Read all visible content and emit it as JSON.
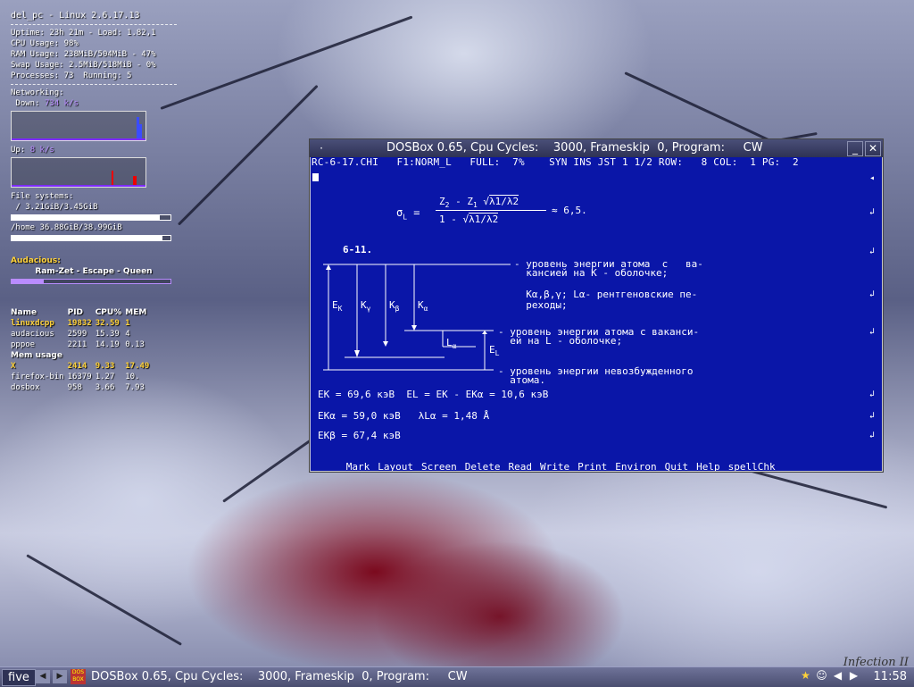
{
  "conky": {
    "host": "del_pc - Linux 2.6.17.13",
    "uptime": "Uptime: 23h 21m - Load: 1.82,1",
    "cpu": "CPU Usage: 98%",
    "cpu_fraction": 0.98,
    "ram": "RAM Usage: 238MiB/504MiB - 47%",
    "ram_fraction": 0.47,
    "swap": "Swap Usage: 2.5MiB/518MiB - 0%",
    "swap_fraction": 0.0,
    "processes": "Processes: 73  Running: 5",
    "networking": "Networking:",
    "down_label": " Down: ",
    "down_value": "734 k/s",
    "up_label": "Up: ",
    "up_value": "8 k/s",
    "filesystems": "File systems:",
    "fs_root": " / 3.21GiB/3.45GiB",
    "fs_root_fraction": 0.93,
    "fs_home": "/home 36.88GiB/38.99GiB",
    "fs_home_fraction": 0.95,
    "audacious_label": "Audacious:",
    "track": "Ram-Zet - Escape - Queen",
    "track_progress": 0.2,
    "proc_headers": [
      "Name",
      "PID",
      "CPU%",
      "MEM"
    ],
    "cpu_procs": [
      [
        "linuxdcpp",
        "19832",
        "32.59",
        "1"
      ],
      [
        "audacious",
        "2599",
        "15.39",
        "4"
      ],
      [
        "pppoe",
        "2211",
        "14.19",
        "0.13"
      ]
    ],
    "mem_usage_label": "Mem usage",
    "mem_procs": [
      [
        "X",
        "2414",
        "9.33",
        "17.49"
      ],
      [
        "firefox-bin",
        "16379",
        "1.27",
        "10."
      ],
      [
        "dosbox",
        "958",
        "3.66",
        "7.93"
      ]
    ]
  },
  "dosbox": {
    "title": "DOSBox 0.65, Cpu Cycles:    3000, Frameskip  0, Program:     CW",
    "status": "RC-6-17.CHI   F1:NORM_L   FULL:  7%    SYN INS JST 1 1/2 ROW:   8 COL:  1 PG:  2",
    "formula": {
      "sigma": "σ",
      "sigma_sub": "L",
      "numer_z2": "Z",
      "numer_z2_sub": "2",
      "numer_minus": " - ",
      "numer_z1": "Z",
      "numer_z1_sub": "1",
      "lambda_ratio": "λ1/λ2",
      "denom": "1 - ",
      "approx": "≈ 6,5."
    },
    "section": "6-11.",
    "levels": [
      "- уровень энергии атома  с   ва-",
      "  кансией на K - оболочке;",
      "  Kα,β,γ; Lα- рентгеновские пе-",
      "  реходы;",
      "- уровень энергии атома с ваканси-",
      "  ей на L - оболочке;",
      "- уровень энергии невозбужденного",
      "  атома."
    ],
    "arrow_labels": {
      "ek": "E",
      "ek_sub": "K",
      "kg": "K",
      "kg_sub": "γ",
      "kb": "K",
      "kb_sub": "β",
      "ka": "K",
      "ka_sub": "α",
      "la": "L",
      "la_sub": "α",
      "el": "E",
      "el_sub": "L"
    },
    "eq1": "E",
    "eq1_text": "K = 69,6 кэВ  E",
    "eq1_b": "L = E",
    "eq1_c": "K - E",
    "eq1_d": "Kα = 10,6 кэВ",
    "eq2_a": "E",
    "eq2_b": "Kα = 59,0 кэВ",
    "eq2_c": "λ",
    "eq2_d": "Lα = 1,48 Å",
    "eq3_a": "E",
    "eq3_b": "Kβ = 67,4 кэВ",
    "menu": [
      "Mark",
      "Layout",
      "Screen",
      "Delete",
      "Read",
      "Write",
      "Print",
      "Environ",
      "Quit",
      "Help",
      "spellChk"
    ]
  },
  "taskbar": {
    "workspace": "five",
    "task_title": "DOSBox 0.65, Cpu Cycles:    3000, Frameskip  0, Program:     CW",
    "clock": "11:58"
  },
  "wm_label": "Infection II",
  "colors": {
    "dos_bg": "#0a16a8",
    "accent_purple": "#b98cff",
    "highlight_yellow": "#ffd23a"
  }
}
